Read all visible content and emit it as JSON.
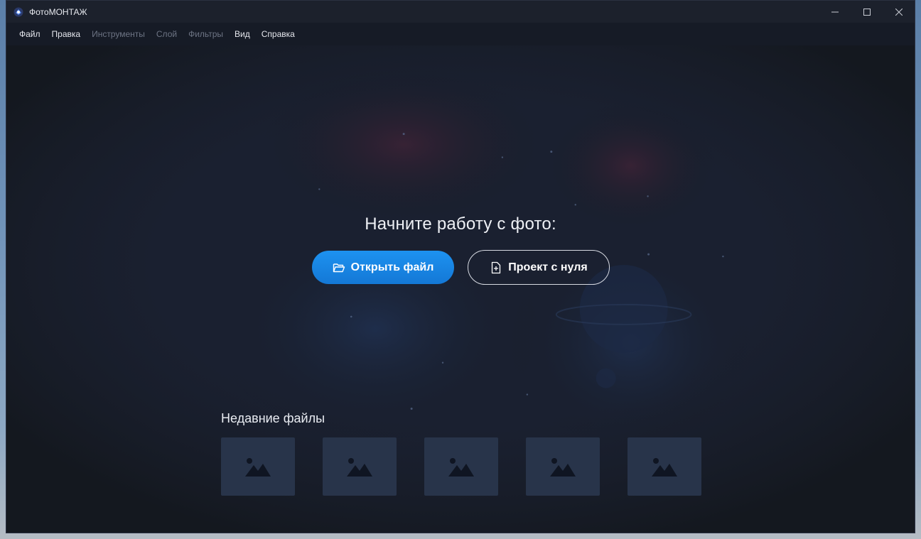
{
  "window": {
    "title": "ФотоМОНТАЖ"
  },
  "menu": [
    {
      "label": "Файл",
      "enabled": true
    },
    {
      "label": "Правка",
      "enabled": true
    },
    {
      "label": "Инструменты",
      "enabled": false
    },
    {
      "label": "Слой",
      "enabled": false
    },
    {
      "label": "Фильтры",
      "enabled": false
    },
    {
      "label": "Вид",
      "enabled": true
    },
    {
      "label": "Справка",
      "enabled": true
    }
  ],
  "start": {
    "title": "Начните работу с фото:",
    "open_button": "Открыть файл",
    "open_icon": "folder-open-icon",
    "new_button": "Проект с нуля",
    "new_icon": "new-file-icon"
  },
  "recent": {
    "title": "Недавние файлы",
    "thumb_icon": "image-placeholder-icon",
    "count": 5
  },
  "colors": {
    "accent": "#1786e6",
    "window_bg": "#161b26",
    "thumb_bg": "#28344a"
  }
}
